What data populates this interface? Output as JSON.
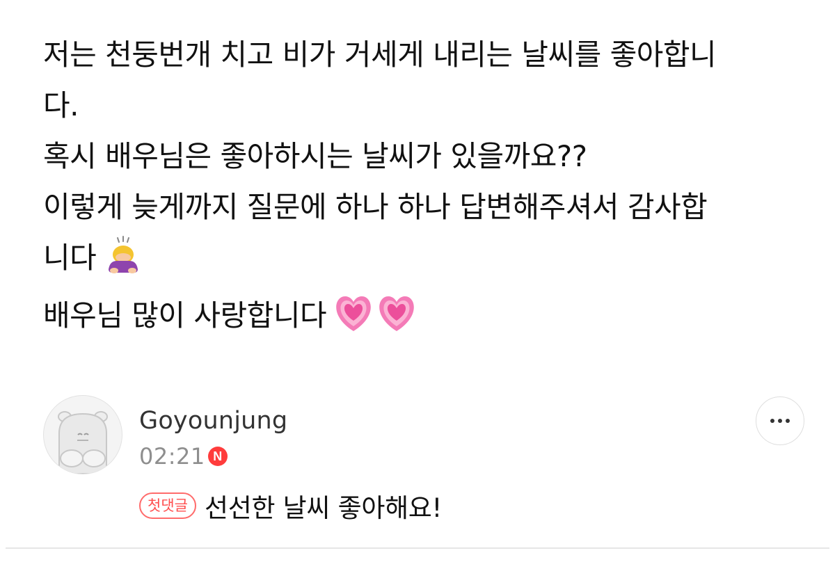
{
  "post": {
    "lines": [
      "저는 천둥번개 치고 비가 거세게 내리는 날씨를 좋아합니",
      "다.",
      "혹시 배우님은 좋아하시는 날씨가 있을까요??",
      "이렇게 늦게까지 질문에 하나 하나 답변해주셔서 감사합",
      "니다",
      "배우님 많이 사랑합니다"
    ],
    "emojis": {
      "bowing": "bowing-woman-emoji",
      "hearts": "growing-heart-emoji"
    }
  },
  "comment": {
    "author": "Goyounjung",
    "time": "02:21",
    "new_badge": "N",
    "first_badge": "첫댓글",
    "text": "선선한 날씨 좋아해요!",
    "more_icon": "more-horizontal-icon"
  },
  "colors": {
    "text": "#111111",
    "meta": "#8e8e8e",
    "accent": "#ff4f4f",
    "divider": "#e6e6e6"
  }
}
